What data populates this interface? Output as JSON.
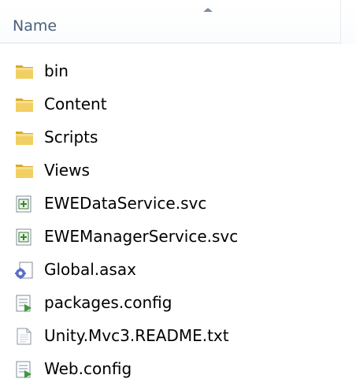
{
  "header": {
    "column_name": "Name",
    "sort": "ascending"
  },
  "files": [
    {
      "name": "bin",
      "icon": "folder-icon"
    },
    {
      "name": "Content",
      "icon": "folder-icon"
    },
    {
      "name": "Scripts",
      "icon": "folder-icon"
    },
    {
      "name": "Views",
      "icon": "folder-icon"
    },
    {
      "name": "EWEDataService.svc",
      "icon": "svc-file-icon"
    },
    {
      "name": "EWEManagerService.svc",
      "icon": "svc-file-icon"
    },
    {
      "name": "Global.asax",
      "icon": "asax-file-icon"
    },
    {
      "name": "packages.config",
      "icon": "config-file-icon"
    },
    {
      "name": "Unity.Mvc3.README.txt",
      "icon": "text-file-icon"
    },
    {
      "name": "Web.config",
      "icon": "config-file-icon"
    }
  ],
  "colors": {
    "header_text": "#4c607a",
    "folder": "#e8c14a",
    "background": "#ffffff"
  }
}
